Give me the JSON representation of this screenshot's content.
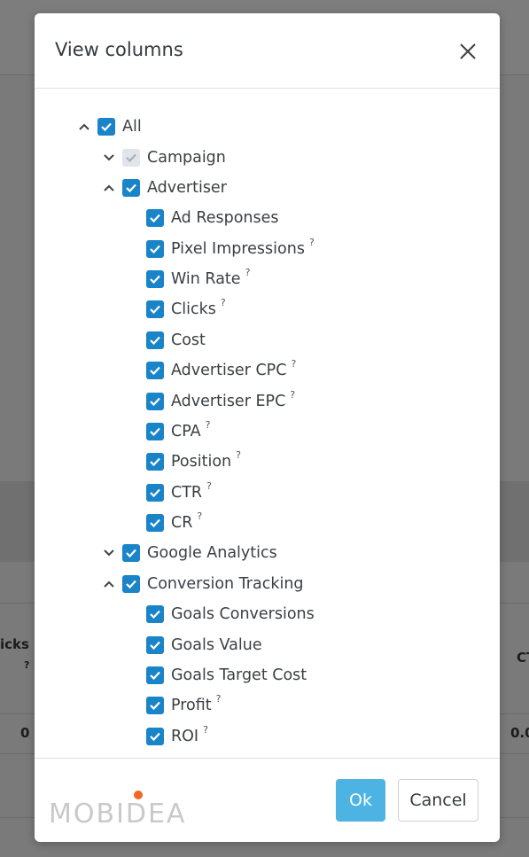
{
  "background": {
    "left_col_header": "icks",
    "left_col_q": "?",
    "left_col_value": "0",
    "right_col_header": "CT",
    "right_col_value": "0.0"
  },
  "modal": {
    "title": "View columns",
    "close_icon": "close-icon"
  },
  "tree": {
    "all": {
      "label": "All",
      "checked": true,
      "expanded": true
    },
    "campaign": {
      "label": "Campaign",
      "checked": true,
      "disabled": true,
      "expanded": false
    },
    "advertiser": {
      "label": "Advertiser",
      "checked": true,
      "expanded": true,
      "items": [
        {
          "label": "Ad Responses",
          "help": ""
        },
        {
          "label": "Pixel Impressions",
          "help": "?"
        },
        {
          "label": "Win Rate",
          "help": "?"
        },
        {
          "label": "Clicks",
          "help": "?"
        },
        {
          "label": "Cost",
          "help": ""
        },
        {
          "label": "Advertiser CPC",
          "help": "?"
        },
        {
          "label": "Advertiser EPC",
          "help": "?"
        },
        {
          "label": "CPA",
          "help": "?"
        },
        {
          "label": "Position",
          "help": "?"
        },
        {
          "label": "CTR",
          "help": "?"
        },
        {
          "label": "CR",
          "help": "?"
        }
      ]
    },
    "google_analytics": {
      "label": "Google Analytics",
      "checked": true,
      "expanded": false
    },
    "conversion_tracking": {
      "label": "Conversion Tracking",
      "checked": true,
      "expanded": true,
      "items": [
        {
          "label": "Goals Conversions",
          "help": ""
        },
        {
          "label": "Goals Value",
          "help": ""
        },
        {
          "label": "Goals Target Cost",
          "help": ""
        },
        {
          "label": "Profit",
          "help": "?"
        },
        {
          "label": "ROI",
          "help": "?"
        }
      ]
    }
  },
  "footer": {
    "logo_text": "MOBIDEA",
    "ok_label": "Ok",
    "cancel_label": "Cancel"
  },
  "colors": {
    "checkbox": "#1a84c9",
    "checkbox_disabled": "#dfe5ea",
    "ok_button": "#4db3e2",
    "logo_dot": "#f26522"
  }
}
